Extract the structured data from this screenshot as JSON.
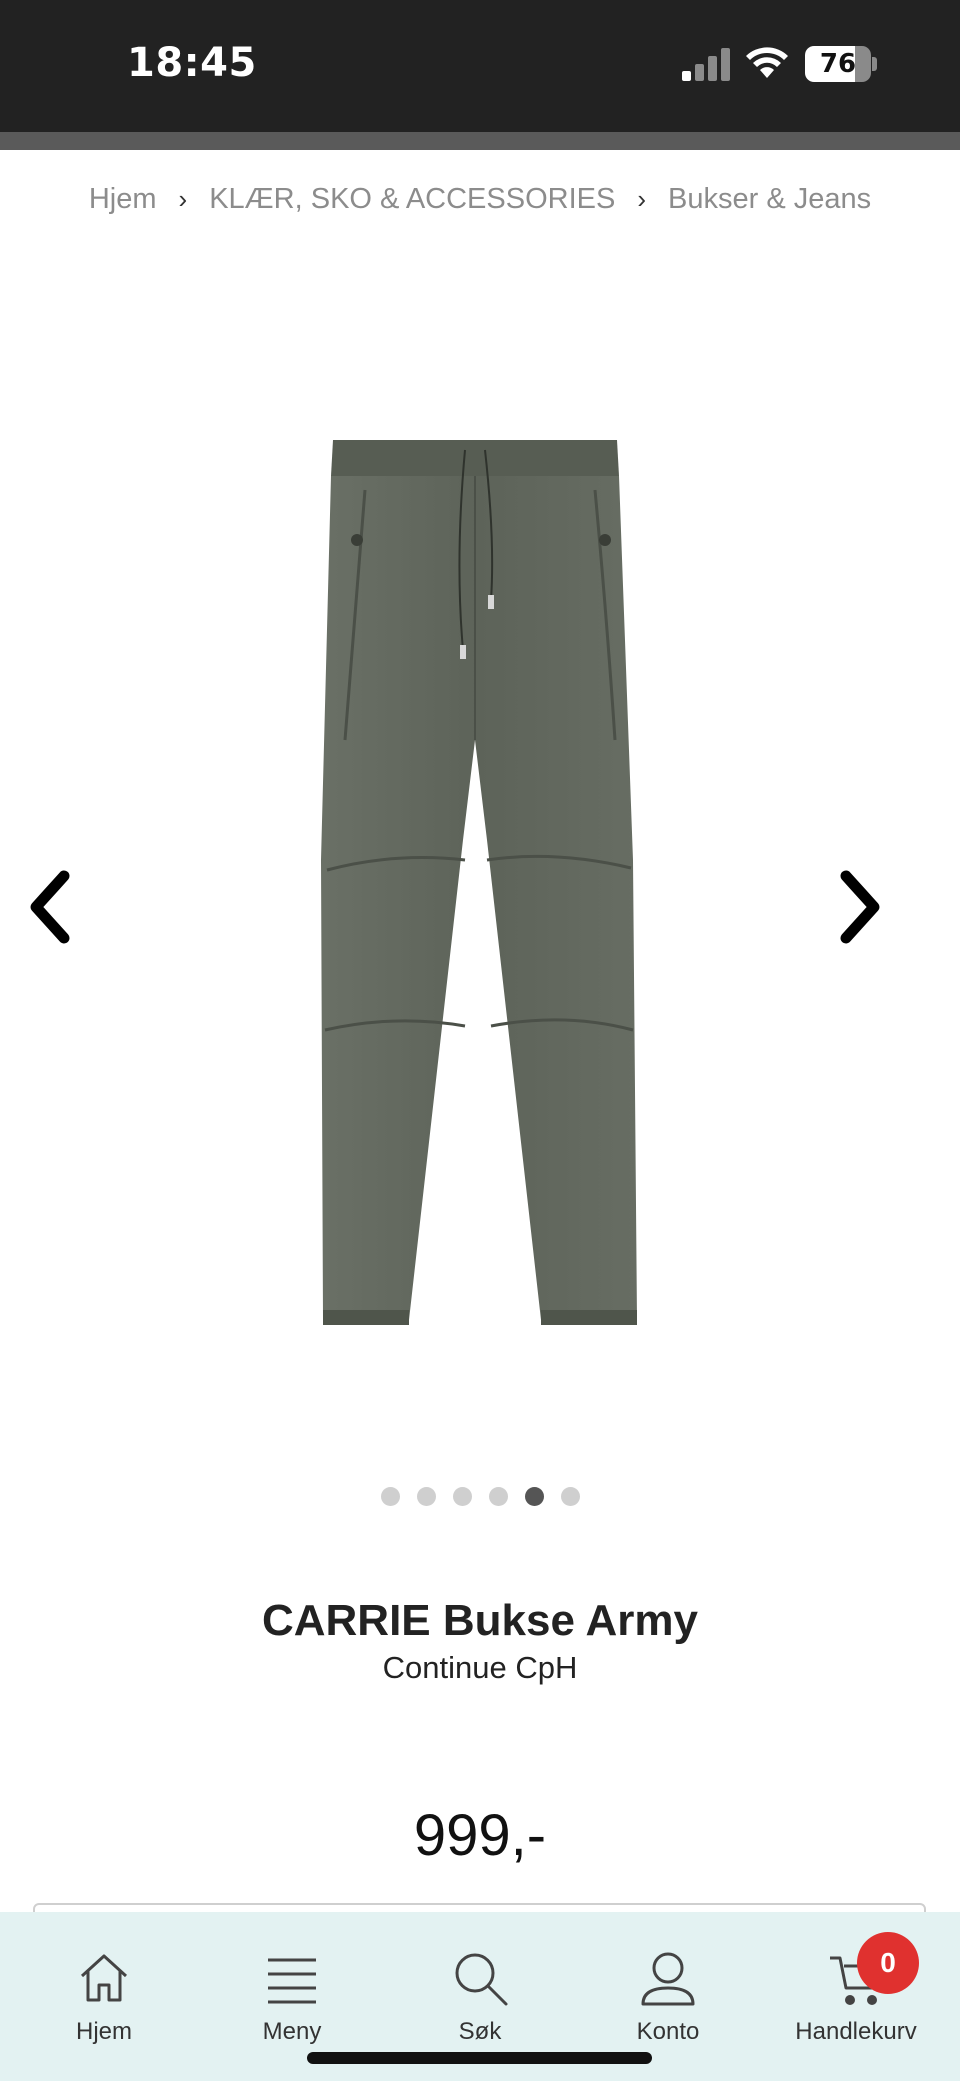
{
  "status_bar": {
    "time": "18:45",
    "battery_level": "76"
  },
  "breadcrumb": {
    "items": [
      "Hjem",
      "KLÆR, SKO & ACCESSORIES",
      "Bukser & Jeans"
    ],
    "separator": "›"
  },
  "carousel": {
    "dot_count": 6,
    "active_index": 4
  },
  "product": {
    "title": "CARRIE Bukse Army",
    "brand": "Continue CpH",
    "price": "999,-"
  },
  "bottom_nav": {
    "items": [
      {
        "label": "Hjem",
        "icon": "home-icon"
      },
      {
        "label": "Meny",
        "icon": "menu-icon"
      },
      {
        "label": "Søk",
        "icon": "search-icon"
      },
      {
        "label": "Konto",
        "icon": "user-icon"
      },
      {
        "label": "Handlekurv",
        "icon": "cart-icon"
      }
    ],
    "cart_count": "0"
  },
  "colors": {
    "status_bar": "#222222",
    "bottom_nav_bg": "#e3f2f2",
    "badge": "#e0312f",
    "product": "#5f655c"
  }
}
